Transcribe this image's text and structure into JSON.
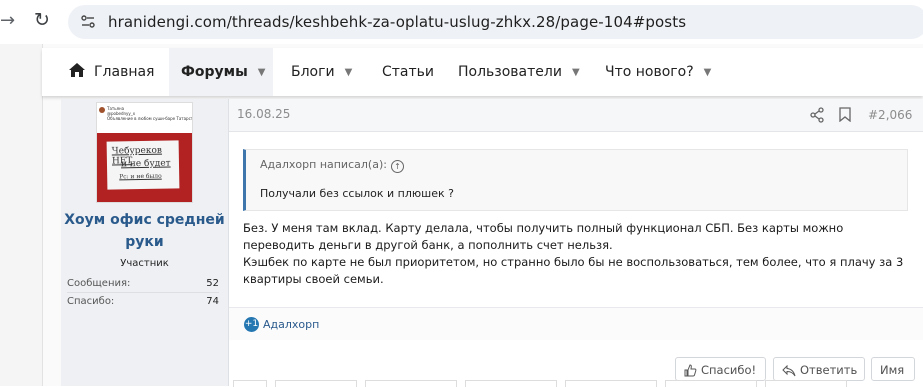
{
  "browser": {
    "url": "hranidengi.com/threads/keshbehk-za-oplatu-uslug-zhkx.28/page-104#posts"
  },
  "nav": {
    "home": "Главная",
    "forums": "Форумы",
    "blogs": "Блоги",
    "articles": "Статьи",
    "users": "Пользователи",
    "whats_new": "Что нового?"
  },
  "user": {
    "avatar_heading": "Татьяна\n@pobednyy_x\nОбъявление в любом суши-баре Татарстана",
    "avatar_sign_line1": "Чебуреков НЕТ",
    "avatar_sign_line2": "и не будет",
    "avatar_sign_line3": "Pc: и не было",
    "name_line1": "Хоум офис средней",
    "name_line2": "руки",
    "title": "Участник",
    "stats": [
      {
        "label": "Сообщения:",
        "value": "52"
      },
      {
        "label": "Спасибо:",
        "value": "74"
      }
    ]
  },
  "post": {
    "date": "16.08.25",
    "number": "#2,066",
    "quote_author": "Адалхорп написал(а):",
    "quote_text": "Получали без ссылок и плюшек ?",
    "body_lines": [
      "Без. У меня там вклад. Карту делала, чтобы получить полный функционал СБП. Без карты можно",
      "переводить деньги в другой банк, а пополнить счет нельзя.",
      "Кэшбек по карте не был приоритетом, но странно было бы не воспользоваться, тем более, что я плачу за 3",
      "квартиры своей семьи."
    ],
    "reaction_count_badge": "+1",
    "reaction_user": "Адалхорп",
    "buttons": {
      "like": "Спасибо!",
      "reply": "Ответить",
      "name": "Имя"
    }
  },
  "colors": {
    "link": "#2a5a8c",
    "quote_border": "#3f76ab",
    "reaction_badge": "#2577b1"
  }
}
